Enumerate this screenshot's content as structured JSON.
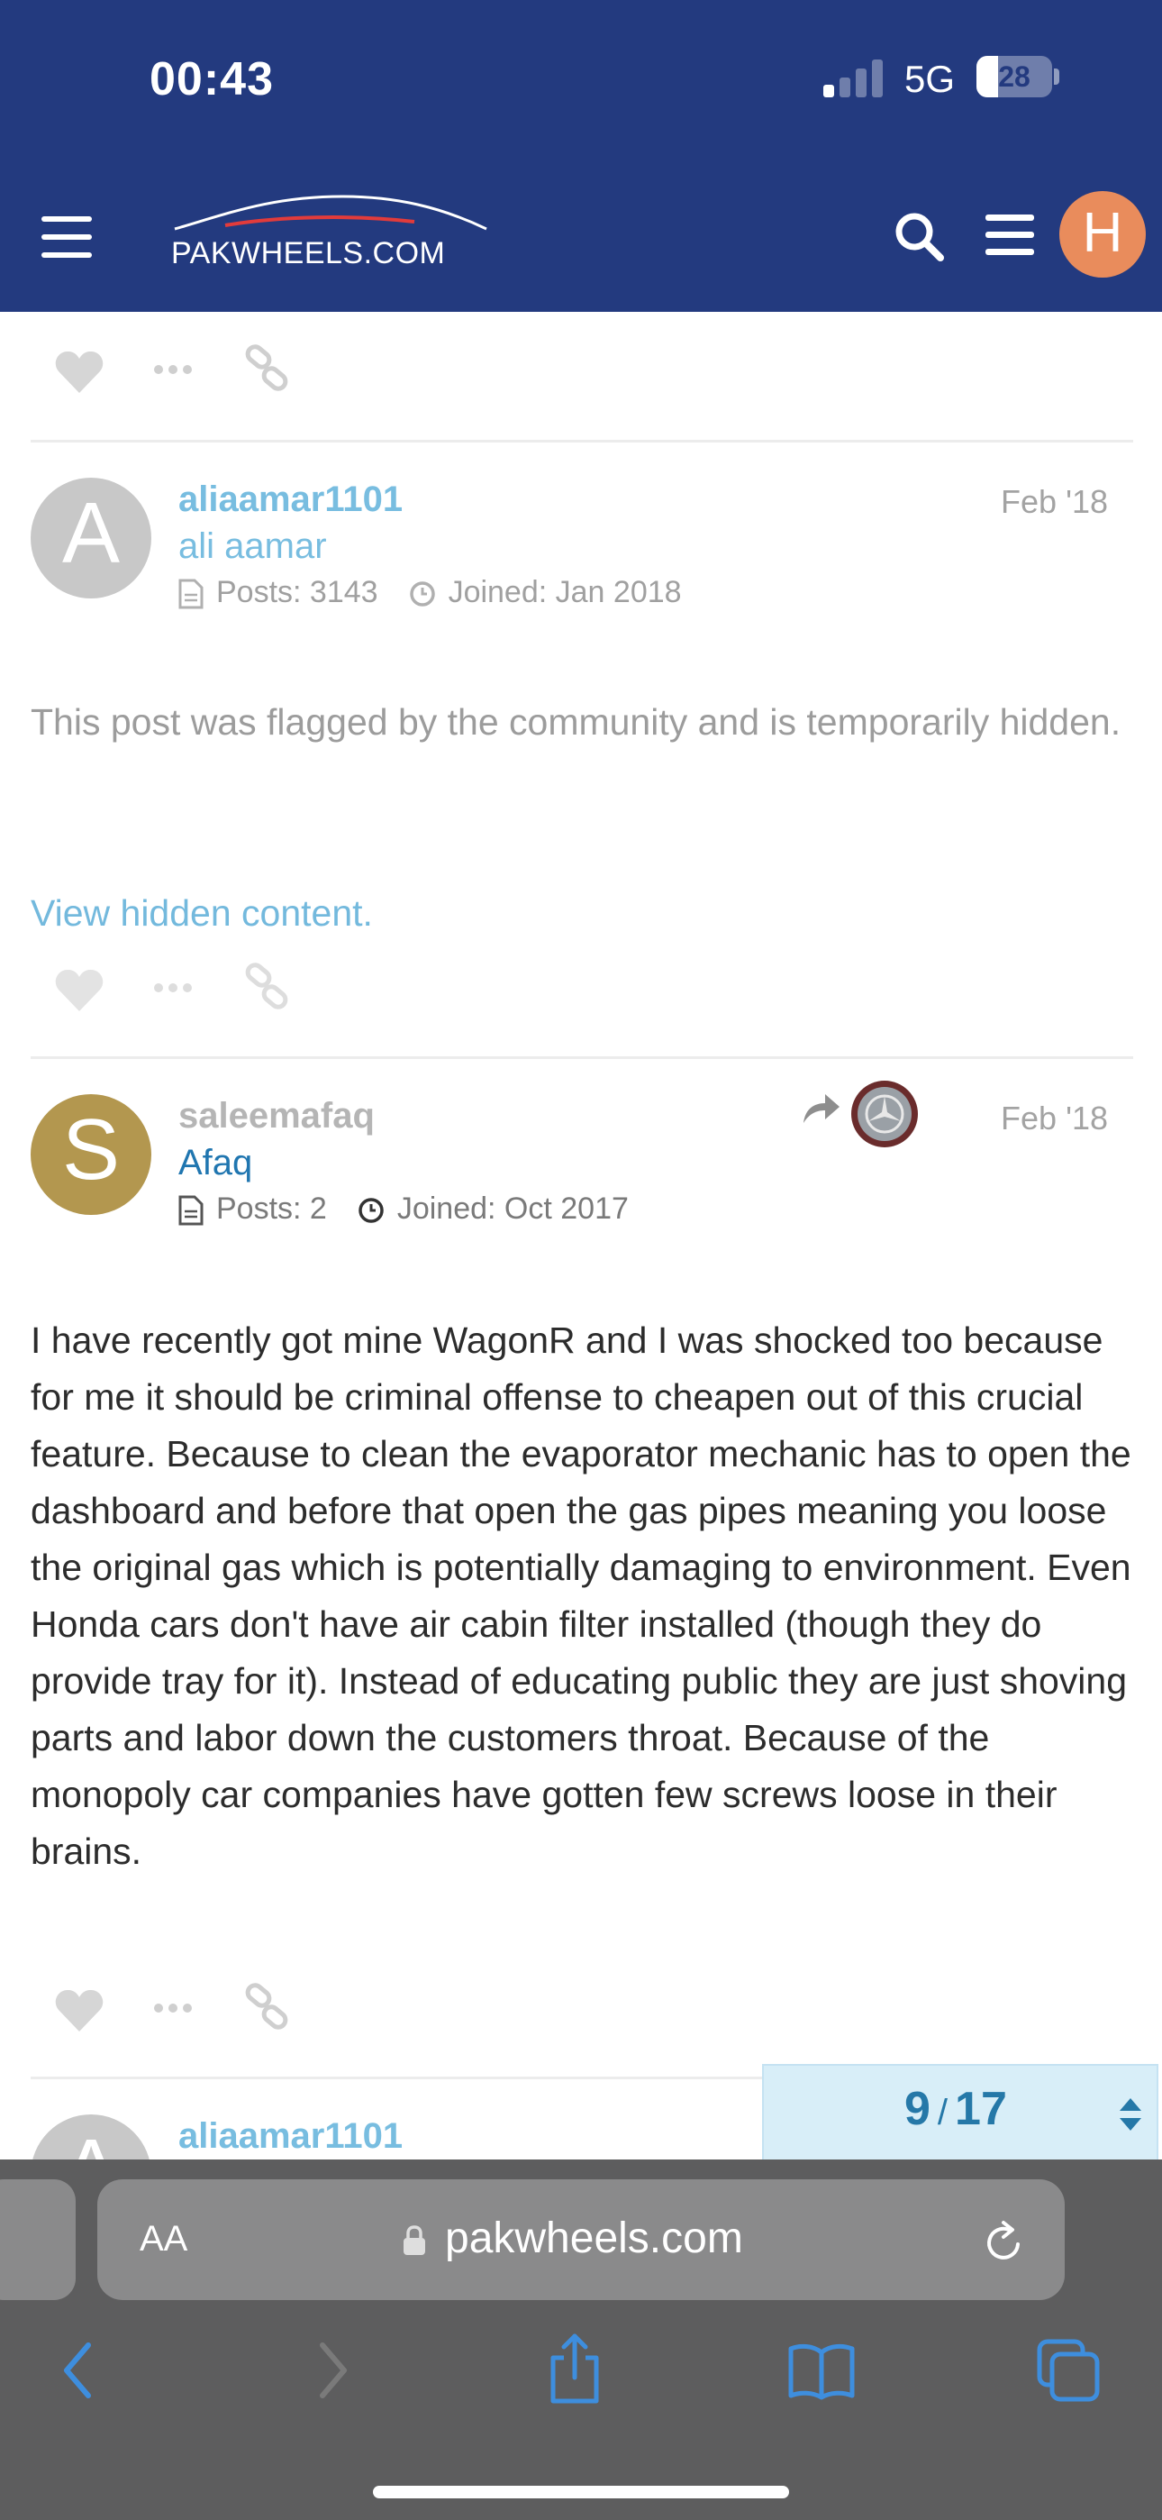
{
  "status_bar": {
    "time": "00:43",
    "network": "5G",
    "battery": "28",
    "battery_level": 0.28
  },
  "header": {
    "logo": "PAKWHEELS.COM",
    "avatar_letter": "H"
  },
  "posts": [
    {
      "avatar_letter": "A",
      "avatar_color": "#c8c8c8",
      "username": "aliaamar1101",
      "full_name": "ali aamar",
      "posts": "Posts: 3143",
      "joined": "Joined: Jan 2018",
      "date": "Feb '18",
      "body": "This post was flagged by the community and is temporarily hidden.",
      "link": "View hidden content."
    },
    {
      "avatar_letter": "S",
      "avatar_color": "#b3974f",
      "username": "saleemafaq",
      "full_name": "Afaq",
      "posts": "Posts: 2",
      "joined": "Joined: Oct 2017",
      "date": "Feb '18",
      "body": "I have recently got mine WagonR and I was shocked too because for me it should be criminal offense to cheapen out of this crucial feature. Because to clean the evaporator mechanic has to open the dashboard and before that open the gas pipes meaning you loose the original gas which is potentially damaging to environment. Even Honda cars don't have air cabin filter installed (though they do provide tray for it). Instead of educating public they are just shoving parts and labor down the customers throat. Because of the monopoly car companies have gotten few screws loose in their brains."
    },
    {
      "avatar_letter": "A",
      "username": "aliaamar1101"
    }
  ],
  "progress": {
    "current": "9",
    "separator": "/",
    "total": "17"
  },
  "browser": {
    "text_size": "AA",
    "domain": "pakwheels.com"
  },
  "colors": {
    "brand": "#233a7f",
    "link": "#73b9dd",
    "link_dark": "#2076b0"
  }
}
